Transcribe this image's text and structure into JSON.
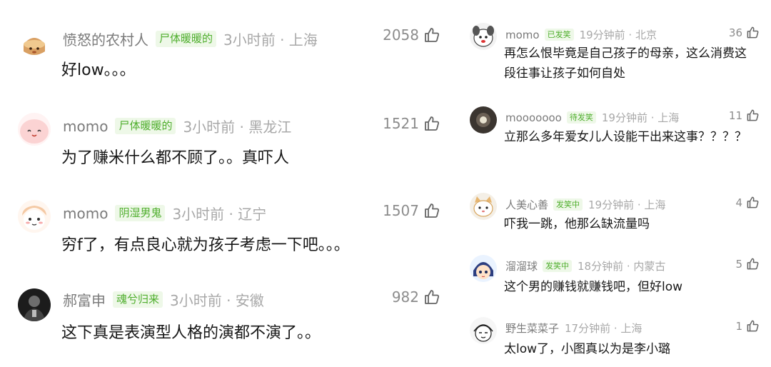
{
  "left": [
    {
      "username": "愤怒的农村人",
      "badge": "尸体暖暖的",
      "time_location": "3小时前 · 上海",
      "text": "好low。。。",
      "likes": "2058",
      "avatar_icon": "pot-dog-avatar-icon"
    },
    {
      "username": "momo",
      "badge": "尸体暖暖的",
      "time_location": "3小时前 · 黑龙江",
      "text": "为了赚米什么都不顾了。。真吓人",
      "likes": "1521",
      "avatar_icon": "pink-blob-avatar-icon"
    },
    {
      "username": "momo",
      "badge": "阴湿男鬼",
      "time_location": "3小时前 · 辽宁",
      "text": "穷f了，有点良心就为孩子考虑一下吧。。。",
      "likes": "1507",
      "avatar_icon": "girl-doodle-avatar-icon"
    },
    {
      "username": "郝富申",
      "badge": "魂兮归来",
      "time_location": "3小时前 · 安徽",
      "text": "这下真是表演型人格的演都不演了。。",
      "likes": "982",
      "avatar_icon": "dark-photo-avatar-icon"
    }
  ],
  "right": [
    {
      "username": "momo",
      "badge": "已发笑",
      "time_location": "19分钟前 · 北京",
      "text": "再怎么恨毕竟是自己孩子的母亲，这么消费这段往事让孩子如何自处",
      "likes": "36",
      "avatar_icon": "cartoon-dog-avatar-icon"
    },
    {
      "username": "mooooooo",
      "badge": "待发笑",
      "time_location": "19分钟前 · 上海",
      "text": "立那么多年爱女儿人设能干出来这事？？？？",
      "likes": "11",
      "avatar_icon": "moon-avatar-icon"
    },
    {
      "username": "人美心善",
      "badge": "发笑中",
      "time_location": "19分钟前 · 上海",
      "text": "吓我一跳，他那么缺流量吗",
      "likes": "4",
      "avatar_icon": "cat-face-avatar-icon"
    },
    {
      "username": "溜溜球",
      "badge": "发笑中",
      "time_location": "18分钟前 · 内蒙古",
      "text": "这个男的赚钱就赚钱吧，但好low",
      "likes": "5",
      "avatar_icon": "anime-girl-avatar-icon"
    },
    {
      "username": "野生菜菜子",
      "badge": "",
      "time_location": "17分钟前 · 上海",
      "text": "太low了，小图真以为是李小璐",
      "likes": "1",
      "avatar_icon": "sketch-face-avatar-icon"
    }
  ],
  "colors": {
    "badge_text": "#4fae2d",
    "badge_bg": "#eef8e8",
    "username": "#7b7b7b",
    "meta": "#a8a8a8"
  }
}
